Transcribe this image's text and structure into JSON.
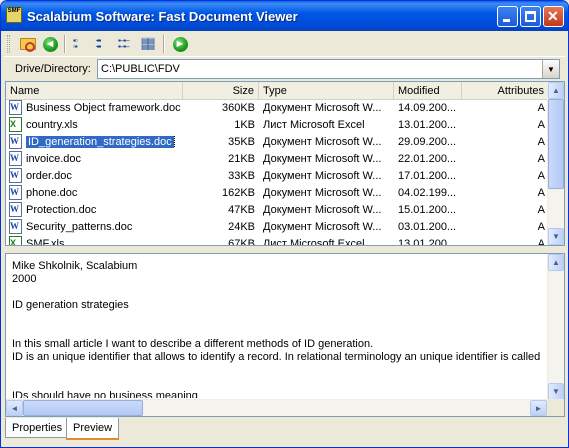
{
  "window": {
    "title": "Scalabium Software: Fast Document Viewer",
    "app_icon_text": "SMF"
  },
  "toolbar": {
    "buttons": [
      {
        "name": "open-folder-icon"
      },
      {
        "name": "back-icon"
      },
      {
        "name": "large-icons-view-icon"
      },
      {
        "name": "small-icons-view-icon"
      },
      {
        "name": "list-view-icon"
      },
      {
        "name": "details-view-icon"
      },
      {
        "name": "forward-icon"
      }
    ]
  },
  "drive": {
    "label": "Drive/Directory:",
    "value": "C:\\PUBLIC\\FDV"
  },
  "filelist": {
    "columns": [
      "Name",
      "Size",
      "Type",
      "Modified",
      "Attributes"
    ],
    "rows": [
      {
        "icon": "word",
        "name": "Business Object framework.doc",
        "size": "360KB",
        "type": "Документ Microsoft W...",
        "modified": "14.09.200...",
        "attr": "A"
      },
      {
        "icon": "excel",
        "name": "country.xls",
        "size": "1KB",
        "type": "Лист Microsoft Excel",
        "modified": "13.01.200...",
        "attr": "A"
      },
      {
        "icon": "word",
        "name": "ID_generation_strategies.doc",
        "size": "35KB",
        "type": "Документ Microsoft W...",
        "modified": "29.09.200...",
        "attr": "A",
        "selected": true
      },
      {
        "icon": "word",
        "name": "invoice.doc",
        "size": "21KB",
        "type": "Документ Microsoft W...",
        "modified": "22.01.200...",
        "attr": "A"
      },
      {
        "icon": "word",
        "name": "order.doc",
        "size": "33KB",
        "type": "Документ Microsoft W...",
        "modified": "17.01.200...",
        "attr": "A"
      },
      {
        "icon": "word",
        "name": "phone.doc",
        "size": "162KB",
        "type": "Документ Microsoft W...",
        "modified": "04.02.199...",
        "attr": "A"
      },
      {
        "icon": "word",
        "name": "Protection.doc",
        "size": "47KB",
        "type": "Документ Microsoft W...",
        "modified": "15.01.200...",
        "attr": "A"
      },
      {
        "icon": "word",
        "name": "Security_patterns.doc",
        "size": "24KB",
        "type": "Документ Microsoft W...",
        "modified": "03.01.200...",
        "attr": "A"
      },
      {
        "icon": "excel",
        "name": "SMF.xls",
        "size": "67KB",
        "type": "Лист Microsoft Excel",
        "modified": "13.01.200...",
        "attr": "A"
      }
    ]
  },
  "preview": {
    "lines": [
      "Mike Shkolnik, Scalabium",
      "2000",
      "",
      "ID generation strategies",
      "",
      "",
      "In this small article I want to describe a different methods of ID generation.",
      "ID is an unique identifier that allows to identify a record. In relational terminology an unique identifier is called a key",
      "",
      "",
      "IDs should have no business meaning"
    ]
  },
  "tabs": [
    {
      "label": "Properties",
      "active": false
    },
    {
      "label": "Preview",
      "active": true
    }
  ]
}
